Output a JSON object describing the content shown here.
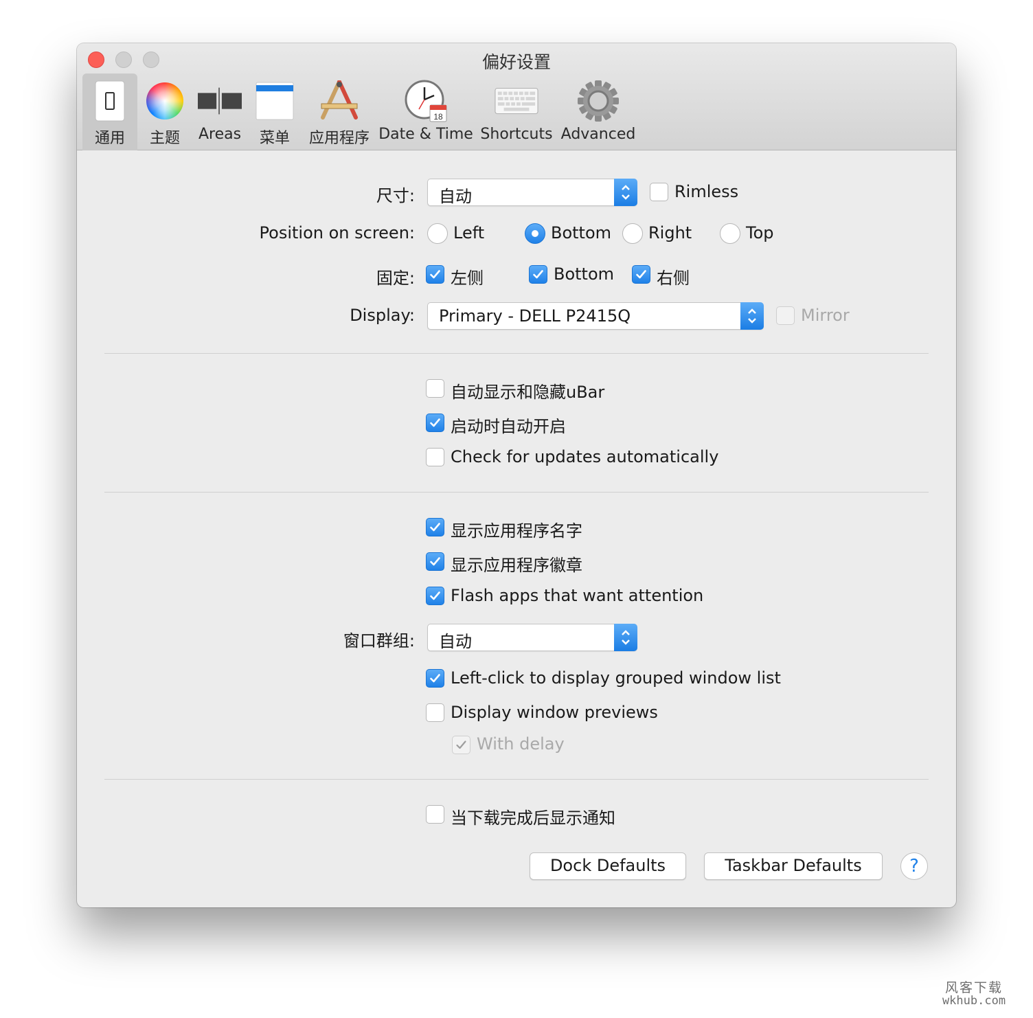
{
  "window": {
    "title": "偏好设置"
  },
  "tabs": [
    {
      "label": "通用",
      "icon": "phone-icon",
      "selected": true
    },
    {
      "label": "主题",
      "icon": "color-wheel-icon"
    },
    {
      "label": "Areas",
      "icon": "areas-icon"
    },
    {
      "label": "菜单",
      "icon": "menu-bar-icon"
    },
    {
      "label": "应用程序",
      "icon": "applications-icon"
    },
    {
      "label": "Date & Time",
      "icon": "clock-calendar-icon"
    },
    {
      "label": "Shortcuts",
      "icon": "keyboard-icon"
    },
    {
      "label": "Advanced",
      "icon": "gear-icon"
    }
  ],
  "size": {
    "label": "尺寸:",
    "value": "自动",
    "rimless_label": "Rimless",
    "rimless": false
  },
  "position": {
    "label": "Position on screen:",
    "options": [
      "Left",
      "Bottom",
      "Right",
      "Top"
    ],
    "selected": "Bottom"
  },
  "pinning": {
    "label": "固定:",
    "options": [
      {
        "label": "左侧",
        "checked": true
      },
      {
        "label": "Bottom",
        "checked": true
      },
      {
        "label": "右侧",
        "checked": true
      }
    ]
  },
  "display": {
    "label": "Display:",
    "value": "Primary - DELL P2415Q",
    "mirror_label": "Mirror",
    "mirror_enabled": false
  },
  "general_options": [
    {
      "label": "自动显示和隐藏uBar",
      "checked": false
    },
    {
      "label": "启动时自动开启",
      "checked": true
    },
    {
      "label": "Check for updates automatically",
      "checked": false
    }
  ],
  "app_options": [
    {
      "label": "显示应用程序名字",
      "checked": true
    },
    {
      "label": "显示应用程序徽章",
      "checked": true
    },
    {
      "label": "Flash apps that want attention",
      "checked": true
    }
  ],
  "grouping": {
    "label": "窗口群组:",
    "value": "自动"
  },
  "group_options": [
    {
      "label": "Left-click to display grouped window list",
      "checked": true
    },
    {
      "label": "Display window previews",
      "checked": false
    }
  ],
  "with_delay": {
    "label": "With delay",
    "checked": true,
    "enabled": false
  },
  "notify_option": {
    "label": "当下载完成后显示通知",
    "checked": false
  },
  "buttons": {
    "dock_defaults": "Dock Defaults",
    "taskbar_defaults": "Taskbar Defaults",
    "help": "?"
  },
  "colors": {
    "accent": "#1f81e8",
    "close": "#fc5f57"
  },
  "watermark": {
    "line1": "风客下载",
    "line2": "wkhub.com"
  }
}
